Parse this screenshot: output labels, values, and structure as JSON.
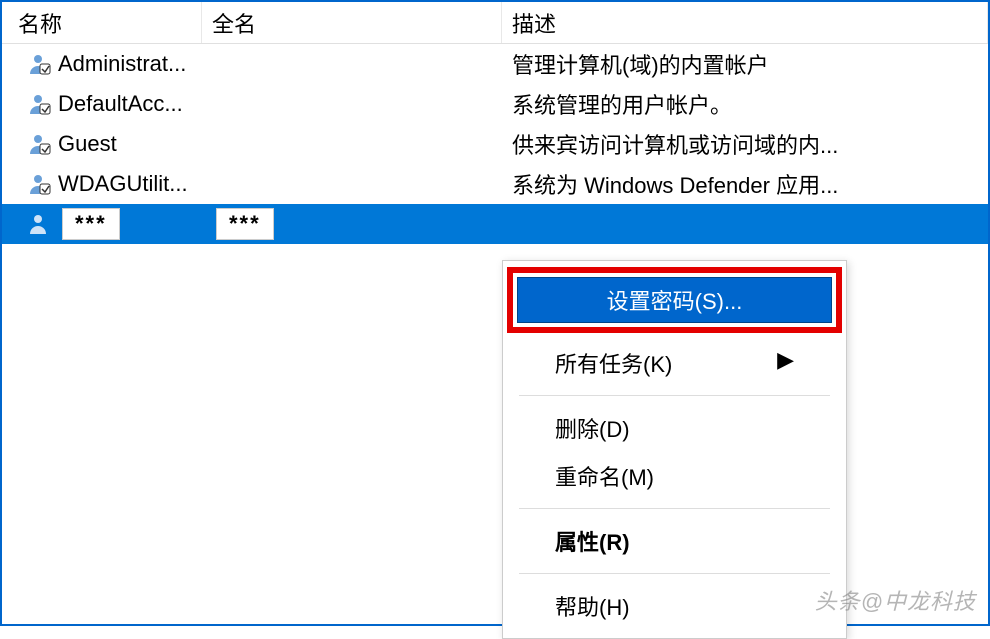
{
  "columns": {
    "name": "名称",
    "fullname": "全名",
    "description": "描述"
  },
  "rows": [
    {
      "name": "Administrat...",
      "fullname": "",
      "description": "管理计算机(域)的内置帐户"
    },
    {
      "name": "DefaultAcc...",
      "fullname": "",
      "description": "系统管理的用户帐户。"
    },
    {
      "name": "Guest",
      "fullname": "",
      "description": "供来宾访问计算机或访问域的内..."
    },
    {
      "name": "WDAGUtilit...",
      "fullname": "",
      "description": "系统为 Windows Defender 应用..."
    }
  ],
  "selected_row": {
    "name_masked": "***",
    "fullname_masked": "***"
  },
  "context_menu": {
    "set_password": "设置密码(S)...",
    "all_tasks": "所有任务(K)",
    "delete": "删除(D)",
    "rename": "重命名(M)",
    "properties": "属性(R)",
    "help": "帮助(H)"
  },
  "watermark": "头条@中龙科技"
}
